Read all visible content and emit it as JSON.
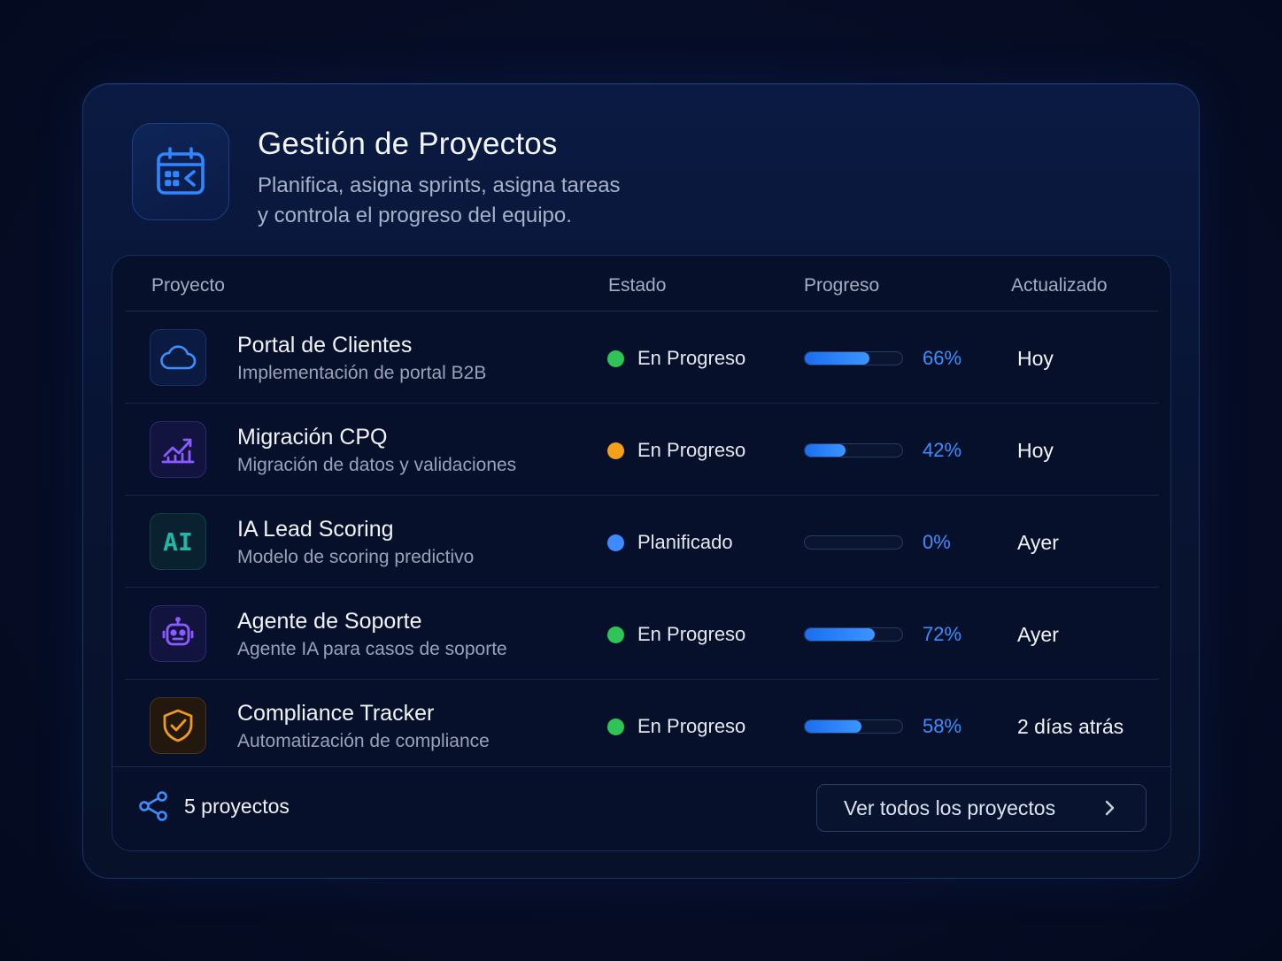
{
  "header": {
    "title": "Gestión de Proyectos",
    "subtitle_line1": "Planifica, asigna sprints, asigna tareas",
    "subtitle_line2": "y controla el progreso del equipo.",
    "icon": "calendar-icon"
  },
  "table": {
    "columns": [
      "Proyecto",
      "Estado",
      "Progreso",
      "Actualizado"
    ],
    "rows": [
      {
        "icon": "cloud-icon",
        "name": "Portal de Clientes",
        "description": "Implementación de portal B2B",
        "status": "En Progreso",
        "status_color": "#2ec456",
        "progress": 66,
        "progress_label": "66%",
        "updated": "Hoy"
      },
      {
        "icon": "chart-trend-icon",
        "name": "Migración CPQ",
        "description": "Migración de datos y validaciones",
        "status": "En Progreso",
        "status_color": "#f5a01a",
        "progress": 42,
        "progress_label": "42%",
        "updated": "Hoy"
      },
      {
        "icon": "ai-icon",
        "name": "IA Lead Scoring",
        "description": "Modelo de scoring predictivo",
        "status": "Planificado",
        "status_color": "#3d8bff",
        "progress": 0,
        "progress_label": "0%",
        "updated": "Ayer",
        "icon_text": "AI"
      },
      {
        "icon": "robot-icon",
        "name": "Agente de Soporte",
        "description": "Agente IA para casos de soporte",
        "status": "En Progreso",
        "status_color": "#2ec456",
        "progress": 72,
        "progress_label": "72%",
        "updated": "Ayer"
      },
      {
        "icon": "shield-check-icon",
        "name": "Compliance Tracker",
        "description": "Automatización de compliance",
        "status": "En Progreso",
        "status_color": "#2ec456",
        "progress": 58,
        "progress_label": "58%",
        "updated": "2 días atrás"
      }
    ]
  },
  "footer": {
    "count_label": "5 proyectos",
    "view_all_label": "Ver todos los proyectos"
  },
  "colors": {
    "accent": "#2f86ff",
    "background": "#060d26",
    "card": "#081433"
  }
}
